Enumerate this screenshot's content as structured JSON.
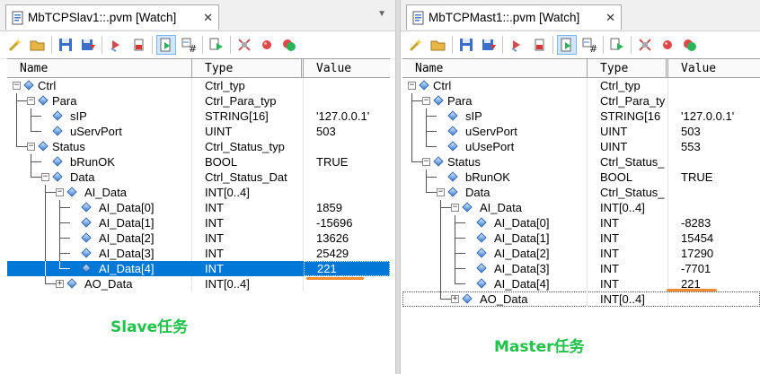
{
  "left": {
    "tab_title": "MbTCPSlav1::.pvm [Watch]",
    "headers": {
      "name": "Name",
      "type": "Type",
      "value": "Value"
    },
    "rows": [
      {
        "depth": 0,
        "name": "Ctrl",
        "type": "Ctrl_typ",
        "value": "",
        "exp": "-"
      },
      {
        "depth": 1,
        "name": "Para",
        "type": "Ctrl_Para_typ",
        "value": "",
        "exp": "-"
      },
      {
        "depth": 2,
        "name": "sIP",
        "type": "STRING[16]",
        "value": "'127.0.0.1'",
        "exp": ""
      },
      {
        "depth": 2,
        "name": "uServPort",
        "type": "UINT",
        "value": "503",
        "exp": ""
      },
      {
        "depth": 1,
        "name": "Status",
        "type": "Ctrl_Status_typ",
        "value": "",
        "exp": "-"
      },
      {
        "depth": 2,
        "name": "bRunOK",
        "type": "BOOL",
        "value": "TRUE",
        "exp": ""
      },
      {
        "depth": 2,
        "name": "Data",
        "type": "Ctrl_Status_Dat",
        "value": "",
        "exp": "-"
      },
      {
        "depth": 3,
        "name": "AI_Data",
        "type": "INT[0..4]",
        "value": "",
        "exp": "-"
      },
      {
        "depth": 4,
        "name": "AI_Data[0]",
        "type": "INT",
        "value": "1859",
        "exp": ""
      },
      {
        "depth": 4,
        "name": "AI_Data[1]",
        "type": "INT",
        "value": "-15696",
        "exp": ""
      },
      {
        "depth": 4,
        "name": "AI_Data[2]",
        "type": "INT",
        "value": "13626",
        "exp": ""
      },
      {
        "depth": 4,
        "name": "AI_Data[3]",
        "type": "INT",
        "value": "25429",
        "exp": ""
      },
      {
        "depth": 4,
        "name": "AI_Data[4]",
        "type": "INT",
        "value": "221",
        "exp": "",
        "selected": true
      },
      {
        "depth": 3,
        "name": "AO_Data",
        "type": "INT[0..4]",
        "value": "",
        "exp": "+"
      }
    ],
    "caption": "Slave任务"
  },
  "right": {
    "tab_title": "MbTCPMast1::.pvm [Watch]",
    "headers": {
      "name": "Name",
      "type": "Type",
      "value": "Value"
    },
    "rows": [
      {
        "depth": 0,
        "name": "Ctrl",
        "type": "Ctrl_typ",
        "value": "",
        "exp": "-"
      },
      {
        "depth": 1,
        "name": "Para",
        "type": "Ctrl_Para_ty",
        "value": "",
        "exp": "-"
      },
      {
        "depth": 2,
        "name": "sIP",
        "type": "STRING[16",
        "value": "'127.0.0.1'",
        "exp": ""
      },
      {
        "depth": 2,
        "name": "uServPort",
        "type": "UINT",
        "value": "503",
        "exp": ""
      },
      {
        "depth": 2,
        "name": "uUsePort",
        "type": "UINT",
        "value": "553",
        "exp": ""
      },
      {
        "depth": 1,
        "name": "Status",
        "type": "Ctrl_Status_",
        "value": "",
        "exp": "-"
      },
      {
        "depth": 2,
        "name": "bRunOK",
        "type": "BOOL",
        "value": "TRUE",
        "exp": ""
      },
      {
        "depth": 2,
        "name": "Data",
        "type": "Ctrl_Status_",
        "value": "",
        "exp": "-"
      },
      {
        "depth": 3,
        "name": "AI_Data",
        "type": "INT[0..4]",
        "value": "",
        "exp": "-"
      },
      {
        "depth": 4,
        "name": "AI_Data[0]",
        "type": "INT",
        "value": "-8283",
        "exp": ""
      },
      {
        "depth": 4,
        "name": "AI_Data[1]",
        "type": "INT",
        "value": "15454",
        "exp": ""
      },
      {
        "depth": 4,
        "name": "AI_Data[2]",
        "type": "INT",
        "value": "17290",
        "exp": ""
      },
      {
        "depth": 4,
        "name": "AI_Data[3]",
        "type": "INT",
        "value": "-7701",
        "exp": ""
      },
      {
        "depth": 4,
        "name": "AI_Data[4]",
        "type": "INT",
        "value": "221",
        "exp": ""
      },
      {
        "depth": 3,
        "name": "AO_Data",
        "type": "INT[0..4]",
        "value": "",
        "exp": "+",
        "focus": true
      }
    ],
    "caption": "Master任务"
  },
  "toolbar_icons": [
    "insert-variable-icon",
    "open-folder-icon",
    "save-icon",
    "save-down-icon",
    "remove-icon",
    "stop-icon",
    "play-step-icon",
    "hash-step-icon",
    "run-icon",
    "disconnect-icon",
    "breakpoint-icon",
    "reset-icon"
  ],
  "colors": {
    "selection": "#0078d7",
    "caption": "#21c24a",
    "annotation": "#f28a2e",
    "tree_gem": "#3d7fd6"
  }
}
